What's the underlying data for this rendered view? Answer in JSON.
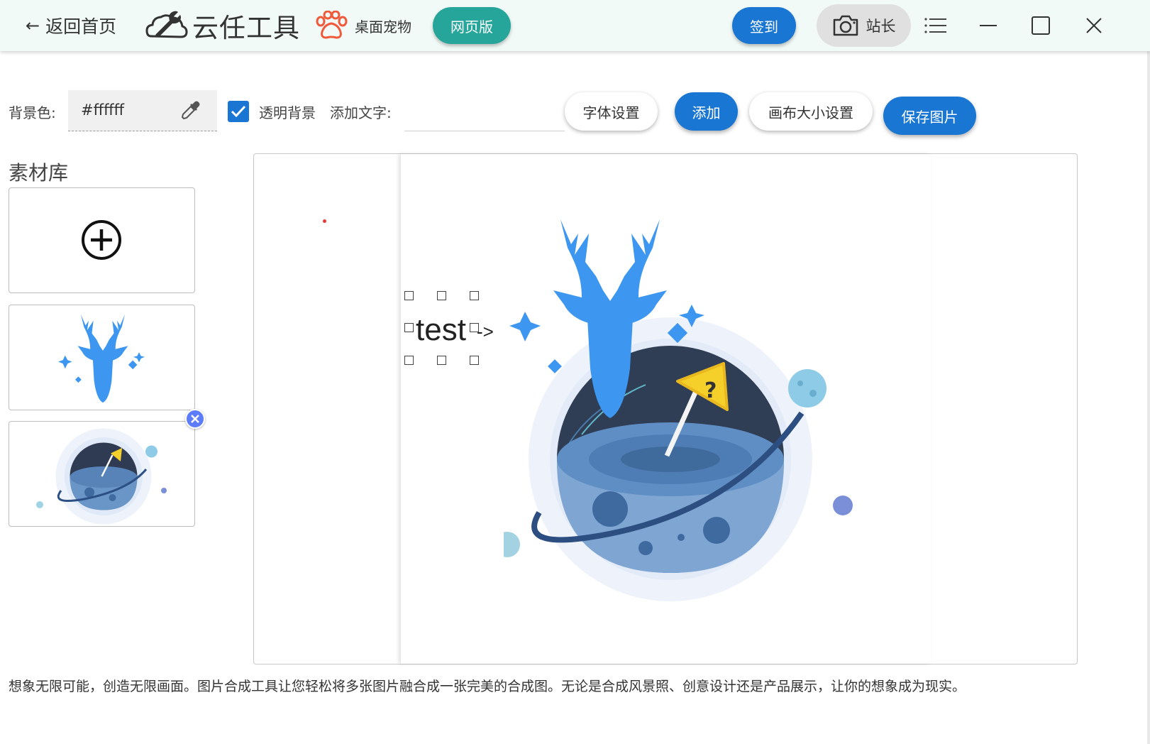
{
  "titlebar": {
    "back_label": "返回首页",
    "app_name": "云任工具",
    "pet_label": "桌面宠物",
    "web_version_label": "网页版",
    "signin_label": "签到",
    "user_label": "站长"
  },
  "toolbar": {
    "bg_color_label": "背景色:",
    "bg_color_value": "#ffffff",
    "transparent_label": "透明背景",
    "transparent_checked": true,
    "add_text_label": "添加文字:",
    "add_text_value": "",
    "font_settings_label": "字体设置",
    "add_label": "添加",
    "canvas_size_label": "画布大小设置",
    "save_label": "保存图片"
  },
  "library": {
    "title": "素材库",
    "items": [
      {
        "type": "add",
        "icon": "plus-circle-icon"
      },
      {
        "type": "image",
        "icon": "deer-head-image"
      },
      {
        "type": "image",
        "icon": "planet-image",
        "selected": true
      }
    ]
  },
  "canvas": {
    "text_layer": "test",
    "arrow_marker": "->"
  },
  "description": "想象无限可能，创造无限画面。图片合成工具让您轻松将多张图片融合成一张完美的合成图。无论是合成风景照、创意设计还是产品展示，让你的想象成为现实。",
  "colors": {
    "accent_blue": "#1976d2",
    "teal": "#26a69a",
    "titlebar_bg": "#f1faf7",
    "deer_blue": "#3d96f0"
  }
}
